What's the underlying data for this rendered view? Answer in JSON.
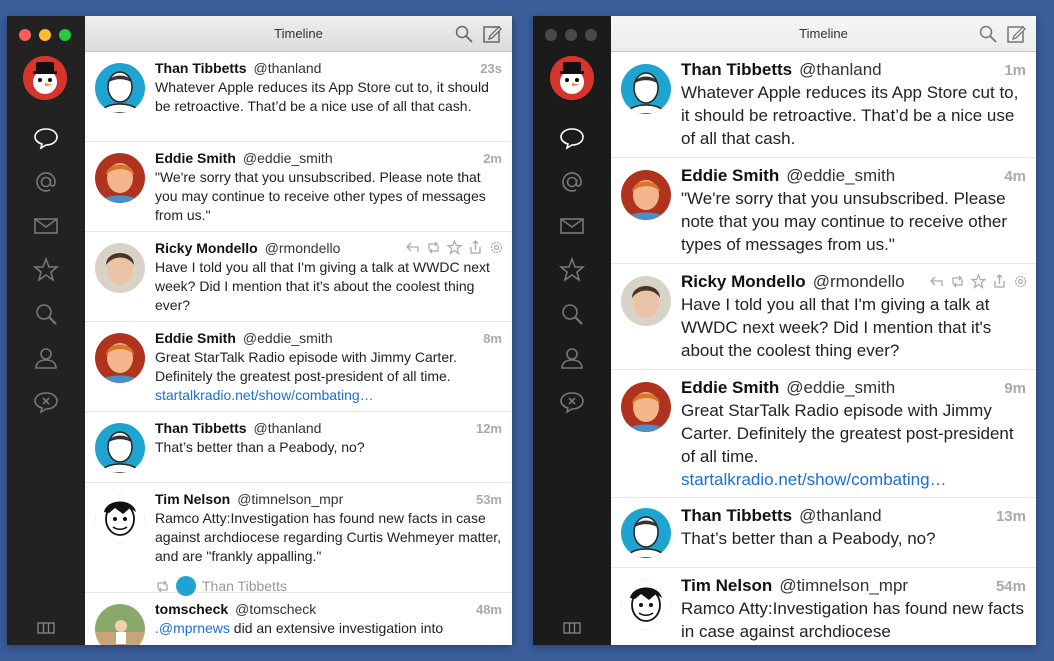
{
  "colors": {
    "desktop": "#3b5e9b",
    "link": "#1a6ed8",
    "time": "#aaaaaa",
    "sidebar": "#222222",
    "avatar_blue": "#1fa3d1",
    "avatar_red": "#c0392b"
  },
  "left_window": {
    "title": "Timeline",
    "sidebar_icons": [
      "speech-bubble-icon",
      "at-icon",
      "envelope-icon",
      "star-icon",
      "search-icon",
      "person-icon",
      "mute-icon"
    ],
    "bottom_icon": "columns-icon",
    "tweets": [
      {
        "name": "Than Tibbetts",
        "handle": "@thanland",
        "time": "23s",
        "text": "Whatever Apple reduces its App Store cut to, it should be retroactive. That’d be a nice use of all that cash."
      },
      {
        "name": "Eddie Smith",
        "handle": "@eddie_smith",
        "time": "2m",
        "text": "\"We're sorry that you unsubscribed. Please note that you may continue to receive other types of messages from us.\""
      },
      {
        "name": "Ricky Mondello",
        "handle": "@rmondello",
        "time": "",
        "text": "Have I told you all that I'm giving a talk at WWDC next week? Did I mention that it's about the coolest thing ever?"
      },
      {
        "name": "Eddie Smith",
        "handle": "@eddie_smith",
        "time": "8m",
        "text": "Great StarTalk Radio episode with Jimmy Carter. Definitely the greatest post-president of all time. ",
        "link": "startalkradio.net/show/combating…"
      },
      {
        "name": "Than Tibbetts",
        "handle": "@thanland",
        "time": "12m",
        "text": "That’s better than a Peabody, no?"
      },
      {
        "name": "Tim Nelson",
        "handle": "@timnelson_mpr",
        "time": "53m",
        "text": "Ramco Atty:Investigation has found new facts in case against archdiocese regarding Curtis Wehmeyer matter, and are \"frankly appalling.\"",
        "retweeted_by": "Than Tibbetts"
      },
      {
        "name": "tomscheck",
        "handle": "@tomscheck",
        "time": "48m",
        "mention": ".@mprnews",
        "text": " did an extensive investigation into"
      }
    ]
  },
  "right_window": {
    "title": "Timeline",
    "tweets": [
      {
        "name": "Than Tibbetts",
        "handle": "@thanland",
        "time": "1m",
        "text": "Whatever Apple reduces its App Store cut to, it should be retroactive. That’d be a nice use of all that cash."
      },
      {
        "name": "Eddie Smith",
        "handle": "@eddie_smith",
        "time": "4m",
        "text": "\"We're sorry that you unsubscribed. Please note that you may continue to receive other types of messages from us.\""
      },
      {
        "name": "Ricky Mondello",
        "handle": "@rmondello",
        "time": "",
        "text": "Have I told you all that I'm giving a talk at WWDC next week? Did I mention that it's about the coolest thing ever?"
      },
      {
        "name": "Eddie Smith",
        "handle": "@eddie_smith",
        "time": "9m",
        "text": "Great StarTalk Radio episode with Jimmy Carter. Definitely the greatest post-president of all time. ",
        "link": "startalkradio.net/show/combating…"
      },
      {
        "name": "Than Tibbetts",
        "handle": "@thanland",
        "time": "13m",
        "text": "That’s better than a Peabody, no?"
      },
      {
        "name": "Tim Nelson",
        "handle": "@timnelson_mpr",
        "time": "54m",
        "text": "Ramco Atty:Investigation has found new facts in case against archdiocese"
      }
    ]
  }
}
